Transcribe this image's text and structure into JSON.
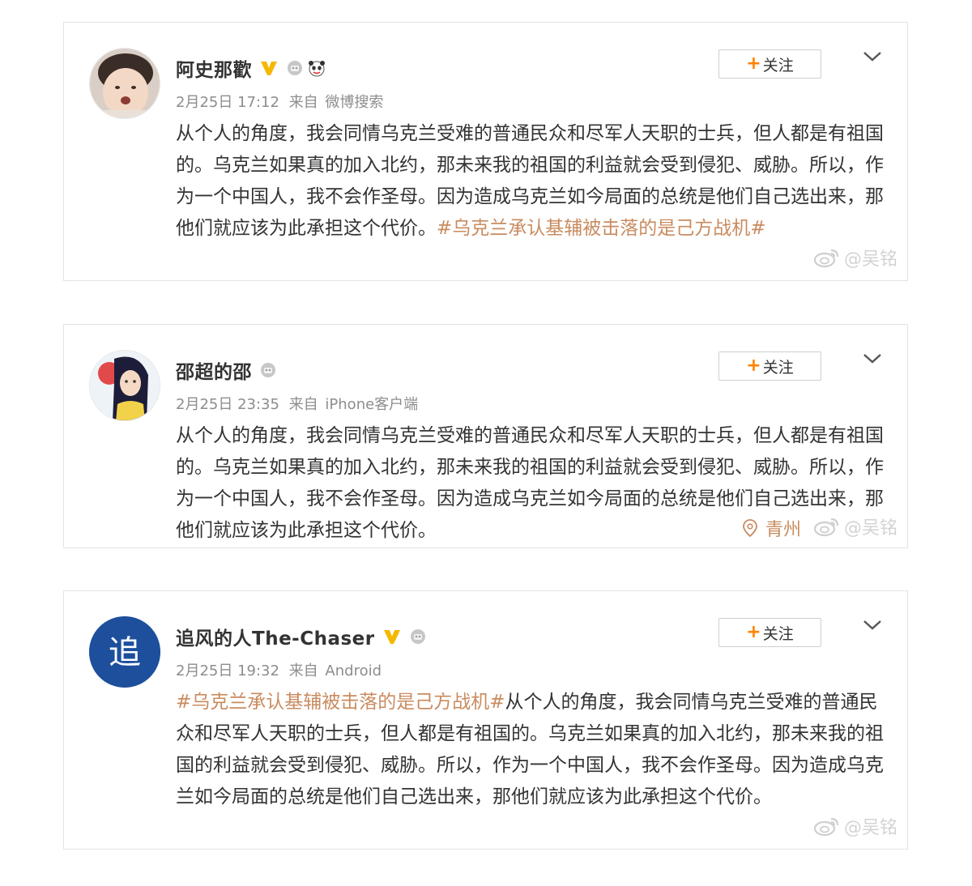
{
  "follow_label": "关注",
  "watermark_text": "@吴铭",
  "posts": [
    {
      "username": "阿史那歡",
      "date": "2月25日 17:12",
      "source_prefix": "来自",
      "source": "微博搜索",
      "text": "从个人的角度，我会同情乌克兰受难的普通民众和尽军人天职的士兵，但人都是有祖国的。乌克兰如果真的加入北约，那未来我的祖国的利益就会受到侵犯、威胁。所以，作为一个中国人，我不会作圣母。因为造成乌克兰如今局面的总统是他们自己选出来，那他们就应该为此承担这个代价。",
      "topic": "#乌克兰承认基辅被击落的是己方战机#",
      "badges": [
        "v-verified-icon",
        "member-level-icon",
        "panda-emoji-icon"
      ]
    },
    {
      "username": "邵超的邵",
      "date": "2月25日 23:35",
      "source_prefix": "来自",
      "source": "iPhone客户端",
      "text": "从个人的角度，我会同情乌克兰受难的普通民众和尽军人天职的士兵，但人都是有祖国的。乌克兰如果真的加入北约，那未来我的祖国的利益就会受到侵犯、威胁。所以，作为一个中国人，我不会作圣母。因为造成乌克兰如今局面的总统是他们自己选出来，那他们就应该为此承担这个代价。",
      "location": "青州",
      "badges": [
        "member-level-icon"
      ]
    },
    {
      "username": "追风的人The-Chaser",
      "date": "2月25日 19:32",
      "source_prefix": "来自",
      "source": "Android",
      "topic": "#乌克兰承认基辅被击落的是己方战机#",
      "text": "从个人的角度，我会同情乌克兰受难的普通民众和尽军人天职的士兵，但人都是有祖国的。乌克兰如果真的加入北约，那未来我的祖国的利益就会受到侵犯、威胁。所以，作为一个中国人，我不会作圣母。因为造成乌克兰如今局面的总统是他们自己选出来，那他们就应该为此承担这个代价。",
      "avatar_glyph": "追",
      "badges": [
        "v-verified-icon",
        "member-level-icon"
      ]
    }
  ],
  "colors": {
    "topic": "#c98b5f",
    "follow_plus": "#ff8200",
    "verified_v": "#f5b800",
    "meta_text": "#8d8d8d",
    "avatar_blue": "#1d4f9c"
  }
}
